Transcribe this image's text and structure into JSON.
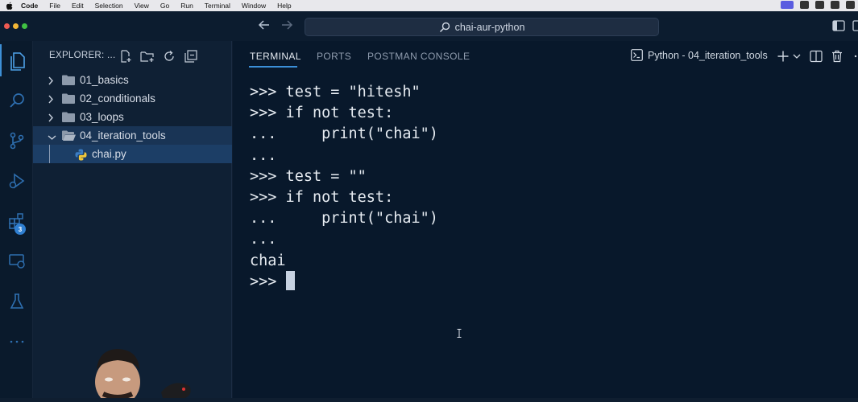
{
  "menubar": {
    "app": "Code",
    "items": [
      "File",
      "Edit",
      "Selection",
      "View",
      "Go",
      "Run",
      "Terminal",
      "Window",
      "Help"
    ]
  },
  "titlebar": {
    "search_label": "chai-aur-python"
  },
  "activity": {
    "extensions_badge": "3"
  },
  "explorer": {
    "title": "EXPLORER: ...",
    "folders": [
      {
        "label": "01_basics",
        "expanded": false
      },
      {
        "label": "02_conditionals",
        "expanded": false
      },
      {
        "label": "03_loops",
        "expanded": false
      },
      {
        "label": "04_iteration_tools",
        "expanded": true
      }
    ],
    "file": {
      "label": "chai.py",
      "icon": "python-icon"
    }
  },
  "panel": {
    "tabs": [
      "TERMINAL",
      "PORTS",
      "POSTMAN CONSOLE"
    ],
    "active_tab": "TERMINAL",
    "terminal_name": "Python - 04_iteration_tools"
  },
  "terminal": {
    "lines": [
      ">>> test = \"hitesh\"",
      ">>> if not test:",
      "...     print(\"chai\")",
      "...",
      ">>> test = \"\"",
      ">>> if not test:",
      "...     print(\"chai\")",
      "...",
      "chai"
    ],
    "prompt": ">>> "
  },
  "colors": {
    "accent": "#3b8fd8",
    "background": "#08182b",
    "sidebar": "#0f2034",
    "badge": "#2f7fd1"
  }
}
